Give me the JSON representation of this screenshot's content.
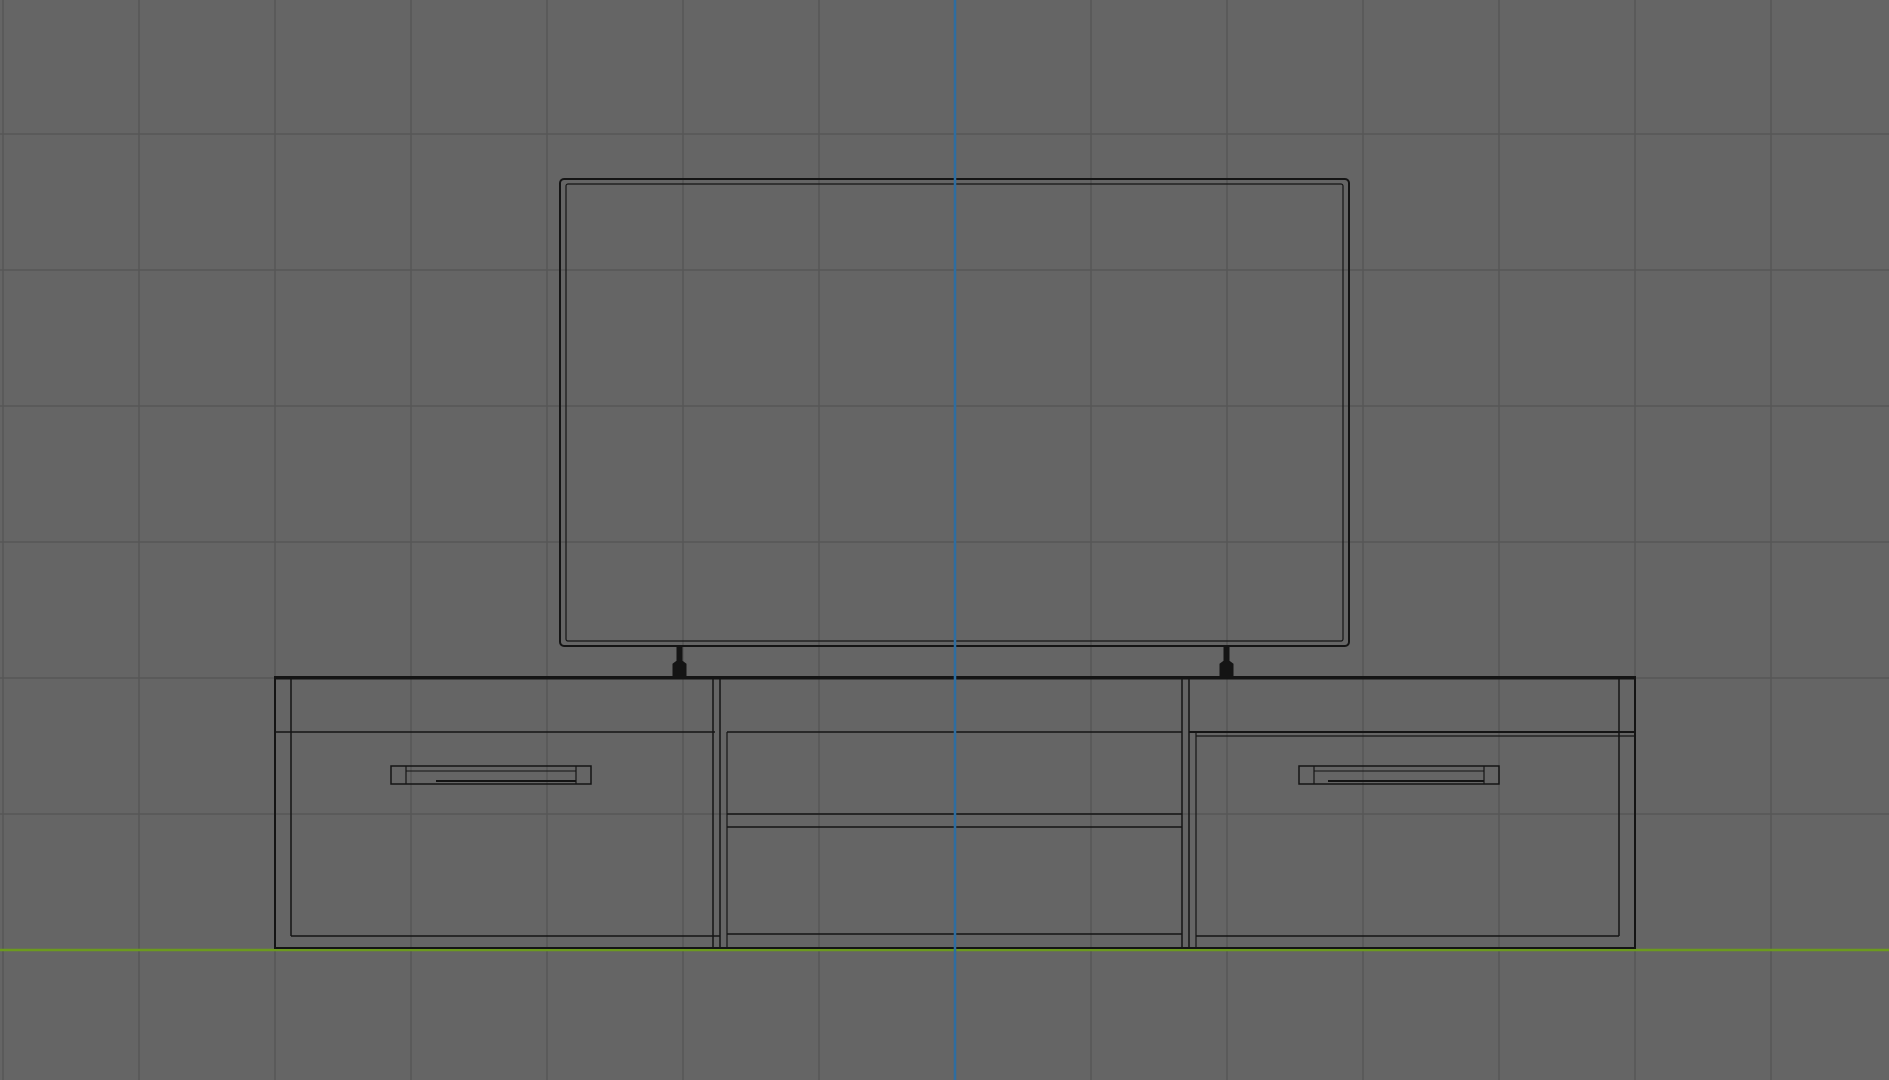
{
  "viewport": {
    "view": "front-orthographic",
    "shading": "wireframe",
    "background_color": "#656565",
    "grid_color": "#575757",
    "wire_color": "#141414",
    "axis_z_color": "#2e6da0",
    "axis_x_color": "#6c9a1e"
  },
  "scene": {
    "objects": [
      {
        "name": "tv-screen",
        "type": "mesh"
      },
      {
        "name": "tv-stand-feet",
        "type": "mesh"
      },
      {
        "name": "tv-cabinet",
        "type": "mesh"
      }
    ]
  }
}
